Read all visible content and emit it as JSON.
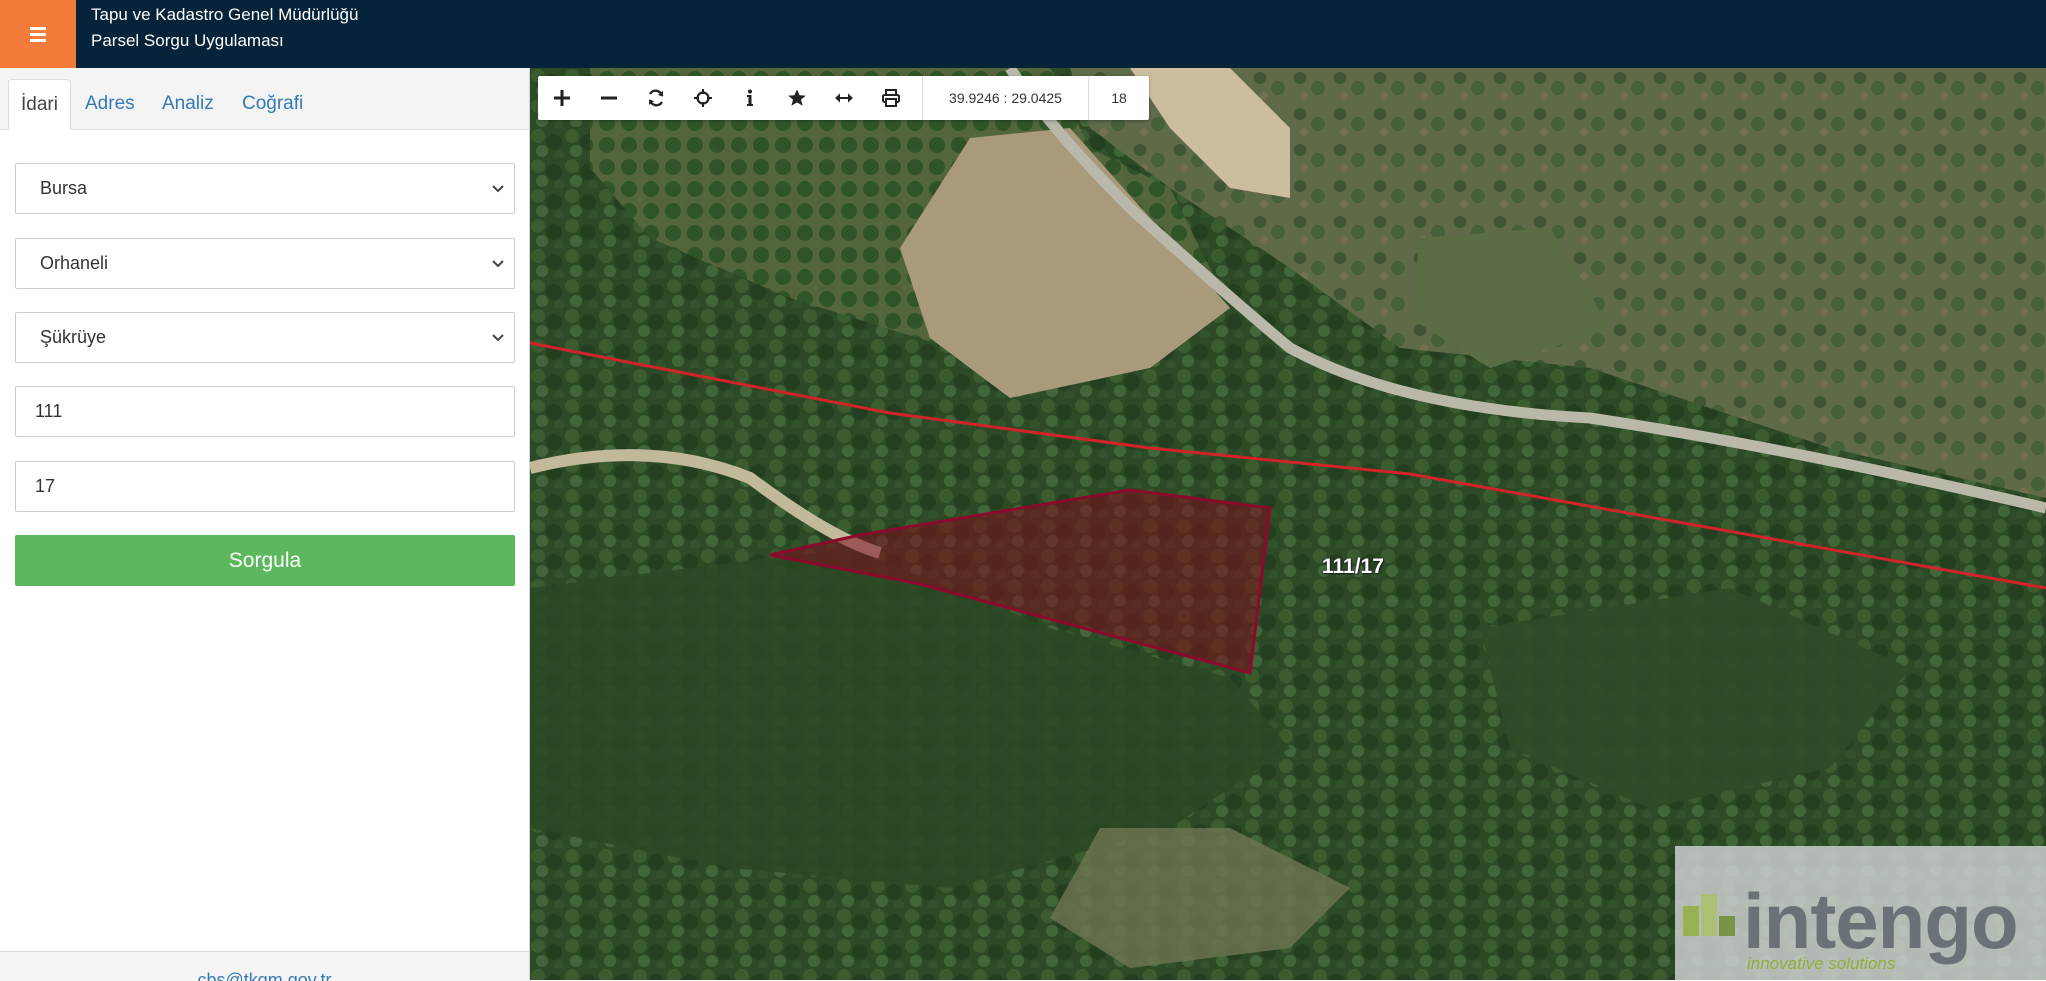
{
  "header": {
    "title_line1": "Tapu ve Kadastro Genel Müdürlüğü",
    "title_line2": "Parsel Sorgu Uygulaması",
    "menu_icon": "hamburger-icon"
  },
  "colors": {
    "header_bg": "#062339",
    "menu_button": "#f47c3a",
    "query_button": "#5cb85c",
    "parcel_outline": "#8b0a2a",
    "boundary_line": "#d1242a"
  },
  "sidebar": {
    "tabs": [
      {
        "label": "İdari",
        "active": true
      },
      {
        "label": "Adres",
        "active": false
      },
      {
        "label": "Analiz",
        "active": false
      },
      {
        "label": "Coğrafi",
        "active": false
      }
    ],
    "form": {
      "province": "Bursa",
      "district": "Orhaneli",
      "neighborhood": "Şükrüye",
      "block": "111",
      "parcel": "17"
    },
    "query_button_label": "Sorgula",
    "footer_email": "cbs@tkgm.gov.tr"
  },
  "map": {
    "toolbar": {
      "tools": [
        "plus-icon",
        "minus-icon",
        "refresh-icon",
        "crosshair-icon",
        "info-icon",
        "star-icon",
        "measure-icon",
        "print-icon"
      ],
      "coordinates": "39.9246 : 29.0425",
      "zoom_level": "18"
    },
    "parcel_label": "111/17",
    "watermark": {
      "word": "intengo",
      "tagline": "innovative solutions"
    }
  }
}
